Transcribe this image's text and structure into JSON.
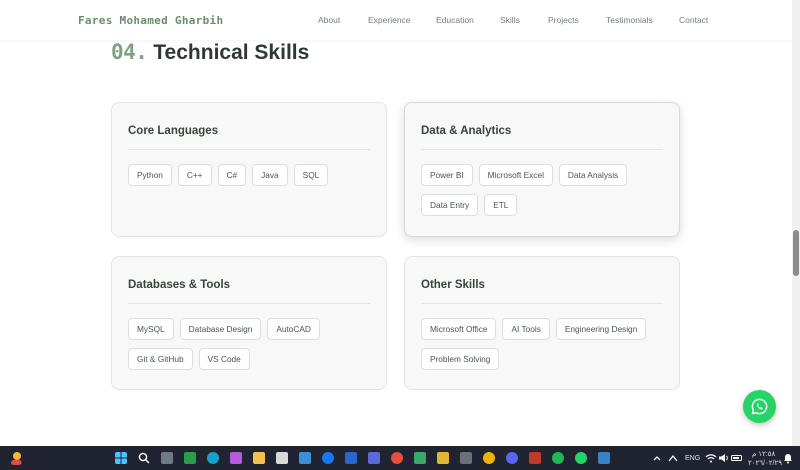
{
  "nav": {
    "logo": "Fares Mohamed Gharbih",
    "links": [
      "About",
      "Experience",
      "Education",
      "Skills",
      "Projects",
      "Testimonials",
      "Contact"
    ]
  },
  "section": {
    "number": "04.",
    "title": "Technical Skills"
  },
  "cards": [
    {
      "title": "Core Languages",
      "tags": [
        "Python",
        "C++",
        "C#",
        "Java",
        "SQL"
      ]
    },
    {
      "title": "Data & Analytics",
      "tags": [
        "Power BI",
        "Microsoft Excel",
        "Data Analysis",
        "Data Entry",
        "ETL"
      ]
    },
    {
      "title": "Databases & Tools",
      "tags": [
        "MySQL",
        "Database Design",
        "AutoCAD",
        "Git & GitHub",
        "VS Code"
      ]
    },
    {
      "title": "Other Skills",
      "tags": [
        "Microsoft Office",
        "AI Tools",
        "Engineering Design",
        "Problem Solving"
      ]
    }
  ],
  "taskbar": {
    "language": "ENG",
    "time": "١٢:٥٨ م",
    "date": "٢٠٢٦/٠٢/٢٩"
  },
  "colors": {
    "accent": "#7ea283",
    "whatsapp": "#25d366",
    "taskbar": "#1f2430"
  }
}
